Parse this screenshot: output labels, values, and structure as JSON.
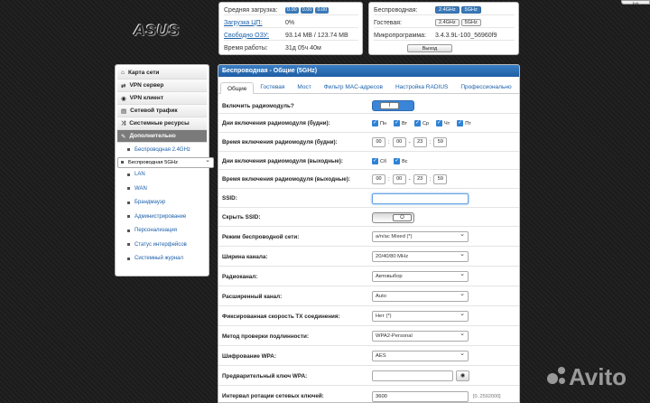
{
  "brand": {
    "logo": "ASUS",
    "corner_button": "Exit"
  },
  "status": {
    "rows": [
      {
        "label": "Средняя загрузка:",
        "badges": [
          "0.00",
          "0.00",
          "0.00"
        ]
      },
      {
        "label": "Загрузка ЦП:",
        "value": "0%",
        "link": true
      },
      {
        "label": "Свободно ОЗУ:",
        "value": "93.14 MB / 123.74 MB",
        "link": true
      },
      {
        "label": "Время работы:",
        "value": "31д 05ч 40м"
      }
    ]
  },
  "wifi": {
    "wireless_label": "Беспроводная:",
    "wireless_chips": [
      "2.4GHz",
      "5GHz"
    ],
    "guest_label": "Гостевая:",
    "guest_chips": [
      "2.4GHz",
      "5GHz"
    ],
    "fw_label": "Микропрограмма:",
    "fw_value": "3.4.3.9L-100_56960f9",
    "exit_label": "Выход"
  },
  "menu": {
    "items": [
      {
        "label": "Карта сети",
        "icon": "home-icon"
      },
      {
        "label": "VPN сервер",
        "icon": "swap-icon"
      },
      {
        "label": "VPN клиент",
        "icon": "globe-icon"
      },
      {
        "label": "Сетевой трафик",
        "icon": "list-icon"
      },
      {
        "label": "Системные ресурсы",
        "icon": "shuffle-icon"
      },
      {
        "label": "Дополнительно",
        "icon": "wrench-icon",
        "active": true
      }
    ],
    "sub": [
      "Беспроводная 2.4GHz",
      "Беспроводная 5GHz",
      "LAN",
      "WAN",
      "Брандмауэр",
      "Администрирование",
      "Персонализация",
      "Статус интерфейсов",
      "Системный журнал"
    ]
  },
  "main": {
    "title": "Беспроводная - Общие (5GHz)",
    "tabs": [
      "Общие",
      "Гостевая",
      "Мост",
      "Фильтр MAC-адресов",
      "Настройка RADIUS",
      "Профессионально"
    ],
    "fields": {
      "radio_label": "Включить радиомодуль?",
      "radio_knob": "I",
      "weekdays_label": "Дни включения радиомодуля (будни):",
      "weekdays": [
        "Пн",
        "Вт",
        "Ср",
        "Чт",
        "Пт"
      ],
      "weektime_label": "Время включения радиомодуля (будни):",
      "weektime": [
        "00",
        "00",
        "23",
        "59"
      ],
      "weekend_label": "Дни включения радиомодуля (выходные):",
      "weekend": [
        "Сб",
        "Вс"
      ],
      "weekendtime_label": "Время включения радиомодуля (выходные):",
      "weekendtime": [
        "00",
        "00",
        "23",
        "59"
      ],
      "ssid_label": "SSID:",
      "ssid_value": "",
      "hide_ssid_label": "Скрыть SSID:",
      "hide_knob": "O",
      "mode_label": "Режим беспроводной сети:",
      "mode_value": "a/n/ac Mixed (*)",
      "width_label": "Ширина канала:",
      "width_value": "20/40/80 MHz",
      "channel_label": "Радиоканал:",
      "channel_value": "Автовыбор",
      "ext_label": "Расширенный канал:",
      "ext_value": "Auto",
      "tx_label": "Фиксированная скорость TX соединения:",
      "tx_value": "Нет (*)",
      "auth_label": "Метод проверки подлинности:",
      "auth_value": "WPA2-Personal",
      "enc_label": "Шифрование WPA:",
      "enc_value": "AES",
      "psk_label": "Предварительный ключ WPA:",
      "psk_value": "",
      "rot_label": "Интервал ротации сетевых ключей:",
      "rot_value": "3600",
      "rot_hint": "[0..2592000]"
    }
  },
  "watermark": "Avito"
}
